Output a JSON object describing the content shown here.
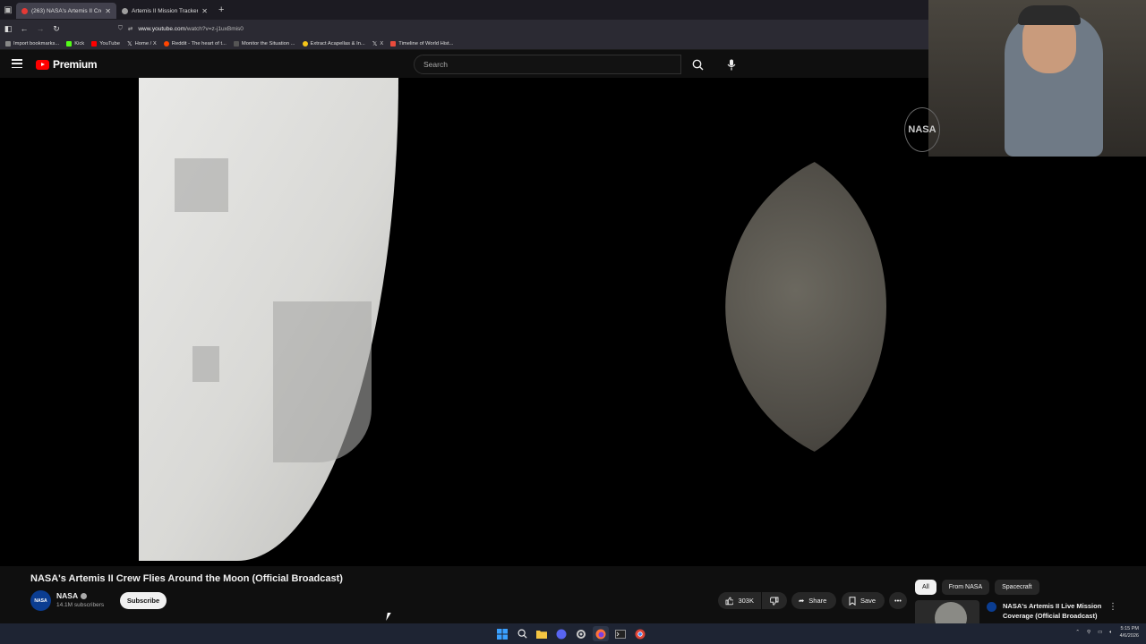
{
  "browser": {
    "tabs": [
      {
        "title": "(263) NASA's Artemis II Cre",
        "active": true
      },
      {
        "title": "Artemis II Mission Tracker | Liv",
        "active": false
      }
    ],
    "url_host": "www.youtube.com",
    "url_path": "/watch?v=z-j1uxBmis0",
    "bookmarks": [
      "Import bookmarks...",
      "Kick",
      "YouTube",
      "Home / X",
      "Reddit - The heart of t...",
      "Monitor the Situation ...",
      "Extract Acapellas & In...",
      "X",
      "Timeline of World Hist..."
    ]
  },
  "youtube": {
    "logo_text": "Premium",
    "search_placeholder": "Search"
  },
  "video": {
    "title": "NASA's Artemis II Crew Flies Around the Moon (Official Broadcast)",
    "overlay_logo": "NASA"
  },
  "channel": {
    "name": "NASA",
    "avatar_text": "NASA",
    "subscribers": "14.1M subscribers",
    "subscribe_label": "Subscribe"
  },
  "actions": {
    "likes": "303K",
    "share": "Share",
    "save": "Save"
  },
  "sidebar": {
    "chips": [
      "All",
      "From NASA",
      "Spacecraft"
    ],
    "recommendation_title": "NASA's Artemis II Live Mission Coverage (Official Broadcast)"
  },
  "taskbar": {
    "time": "5:15 PM",
    "date": "4/6/2026"
  },
  "colors": {
    "youtube_red": "#ff0000",
    "background": "#0f0f0f",
    "taskbar": "#1e2433"
  }
}
